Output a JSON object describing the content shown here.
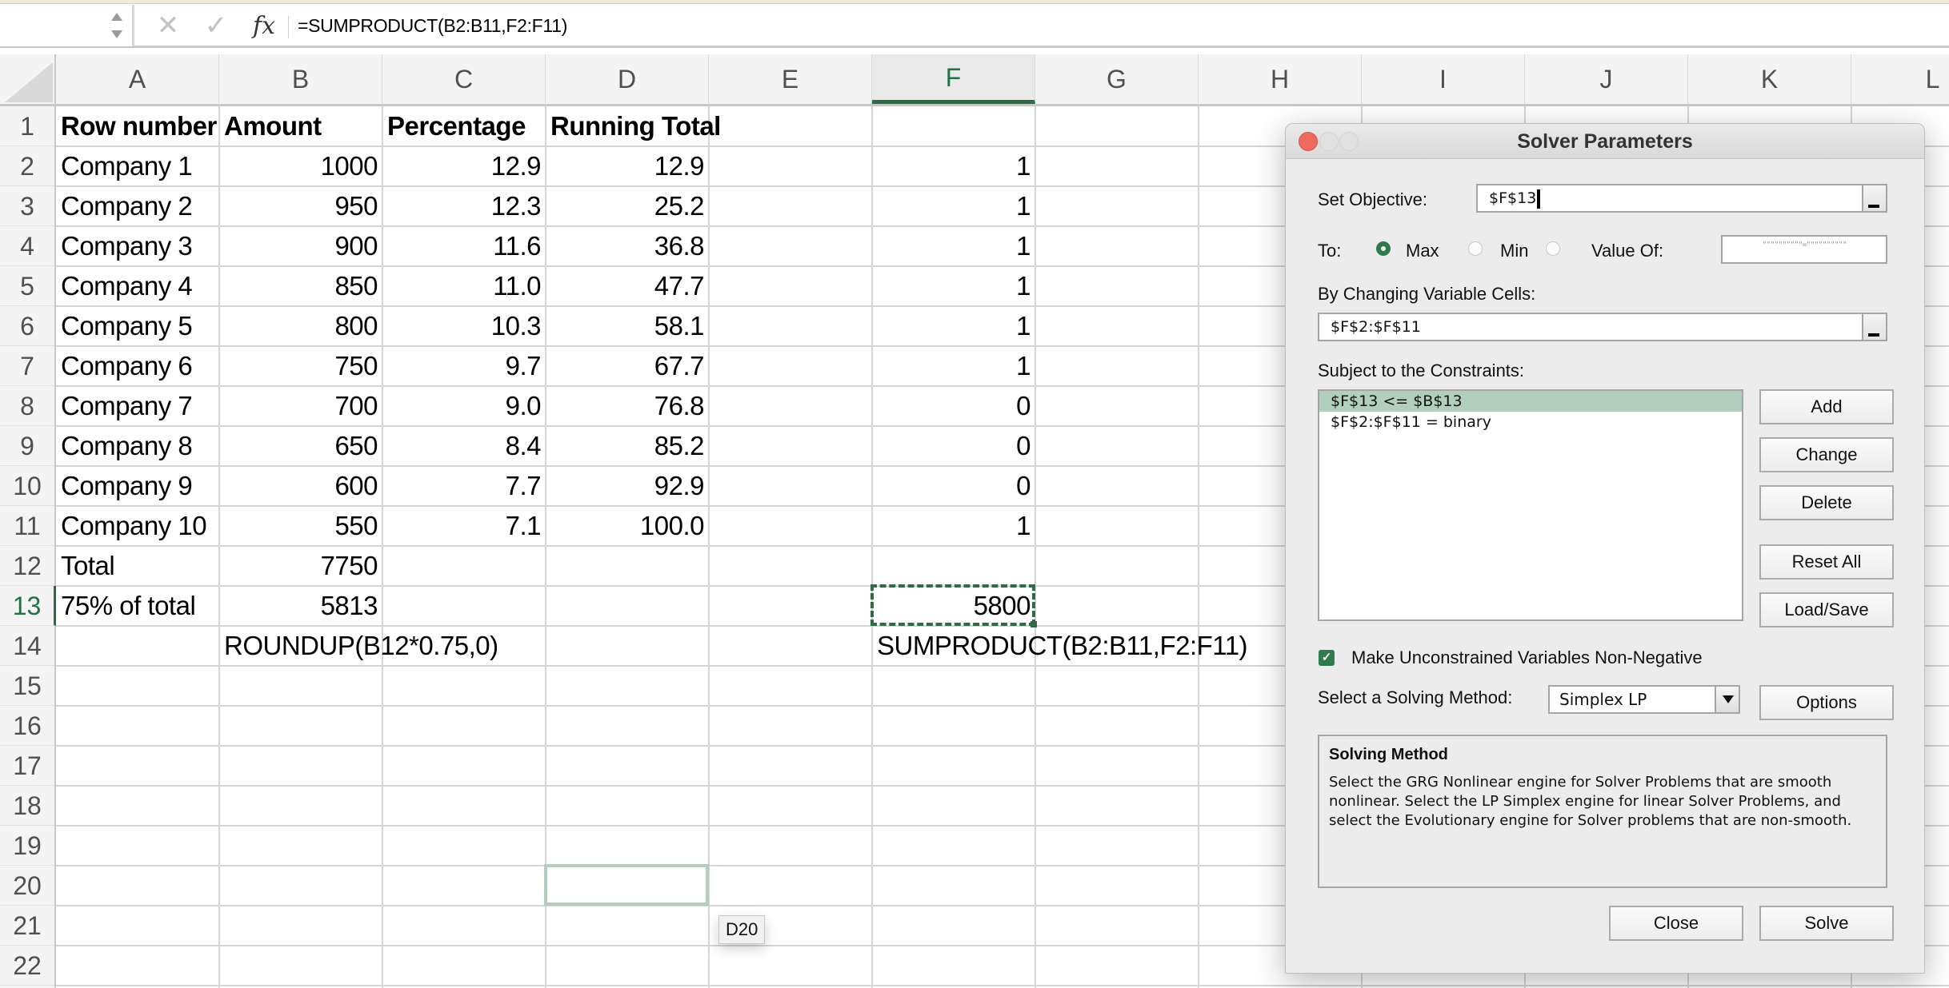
{
  "formula_bar": {
    "name_box_value": "",
    "cancel_icon": "x-icon",
    "enter_icon": "checkmark-icon",
    "fx_label": "fx",
    "formula": "=SUMPRODUCT(B2:B11,F2:F11)"
  },
  "columns": [
    "A",
    "B",
    "C",
    "D",
    "E",
    "F",
    "G",
    "H",
    "I",
    "J",
    "K",
    "L"
  ],
  "active_column": "F",
  "rows": [
    "1",
    "2",
    "3",
    "4",
    "5",
    "6",
    "7",
    "8",
    "9",
    "10",
    "11",
    "12",
    "13",
    "14",
    "15",
    "16",
    "17",
    "18",
    "19",
    "20",
    "21",
    "22"
  ],
  "active_row": "13",
  "sheet": {
    "header": {
      "A": "Row number",
      "B": "Amount",
      "C": "Percentage",
      "D": "Running Total"
    },
    "data": [
      {
        "A": "Company 1",
        "B": "1000",
        "C": "12.9",
        "D": "12.9",
        "F": "1"
      },
      {
        "A": "Company 2",
        "B": "950",
        "C": "12.3",
        "D": "25.2",
        "F": "1"
      },
      {
        "A": "Company 3",
        "B": "900",
        "C": "11.6",
        "D": "36.8",
        "F": "1"
      },
      {
        "A": "Company 4",
        "B": "850",
        "C": "11.0",
        "D": "47.7",
        "F": "1"
      },
      {
        "A": "Company 5",
        "B": "800",
        "C": "10.3",
        "D": "58.1",
        "F": "1"
      },
      {
        "A": "Company 6",
        "B": "750",
        "C": "9.7",
        "D": "67.7",
        "F": "1"
      },
      {
        "A": "Company 7",
        "B": "700",
        "C": "9.0",
        "D": "76.8",
        "F": "0"
      },
      {
        "A": "Company 8",
        "B": "650",
        "C": "8.4",
        "D": "85.2",
        "F": "0"
      },
      {
        "A": "Company 9",
        "B": "600",
        "C": "7.7",
        "D": "92.9",
        "F": "0"
      },
      {
        "A": "Company 10",
        "B": "550",
        "C": "7.1",
        "D": "100.0",
        "F": "1"
      }
    ],
    "total_row": {
      "A": "Total",
      "B": "7750"
    },
    "pct_row": {
      "A": "75% of total",
      "B": "5813",
      "F": "5800"
    },
    "note_row": {
      "B": "ROUNDUP(B12*0.75,0)",
      "F": "SUMPRODUCT(B2:B11,F2:F11)"
    },
    "selected_cell": "D20",
    "tooltip": "D20",
    "copy_cell": "F13"
  },
  "solver": {
    "title": "Solver Parameters",
    "set_objective_label": "Set Objective:",
    "set_objective_value": "$F$13",
    "to_label": "To:",
    "options": [
      {
        "label": "Max",
        "selected": true
      },
      {
        "label": "Min",
        "selected": false
      },
      {
        "label": "Value Of:",
        "selected": false
      }
    ],
    "value_of_value": "\"\"\"\"\"\"\"\"\"\"=\"\"\"\"\"\"\"\"\"\"",
    "changing_cells_label": "By Changing Variable Cells:",
    "changing_cells_value": "$F$2:$F$11",
    "constraints_label": "Subject to the Constraints:",
    "constraints": [
      {
        "text": "$F$13 <= $B$13",
        "selected": true
      },
      {
        "text": "$F$2:$F$11 = binary",
        "selected": false
      }
    ],
    "buttons": {
      "add": "Add",
      "change": "Change",
      "delete": "Delete",
      "reset_all": "Reset All",
      "load_save": "Load/Save",
      "options": "Options",
      "close": "Close",
      "solve": "Solve"
    },
    "non_negative_label": "Make Unconstrained Variables Non-Negative",
    "non_negative_checked": true,
    "method_label": "Select a Solving Method:",
    "method_value": "Simplex LP",
    "method_box_title": "Solving Method",
    "method_box_text": "Select the GRG Nonlinear engine for Solver Problems that are smooth nonlinear. Select the LP Simplex engine for linear Solver Problems, and select the Evolutionary engine for Solver problems that are non-smooth.",
    "accent_color": "#2f7a4f",
    "selection_color": "#b2cfbe"
  }
}
